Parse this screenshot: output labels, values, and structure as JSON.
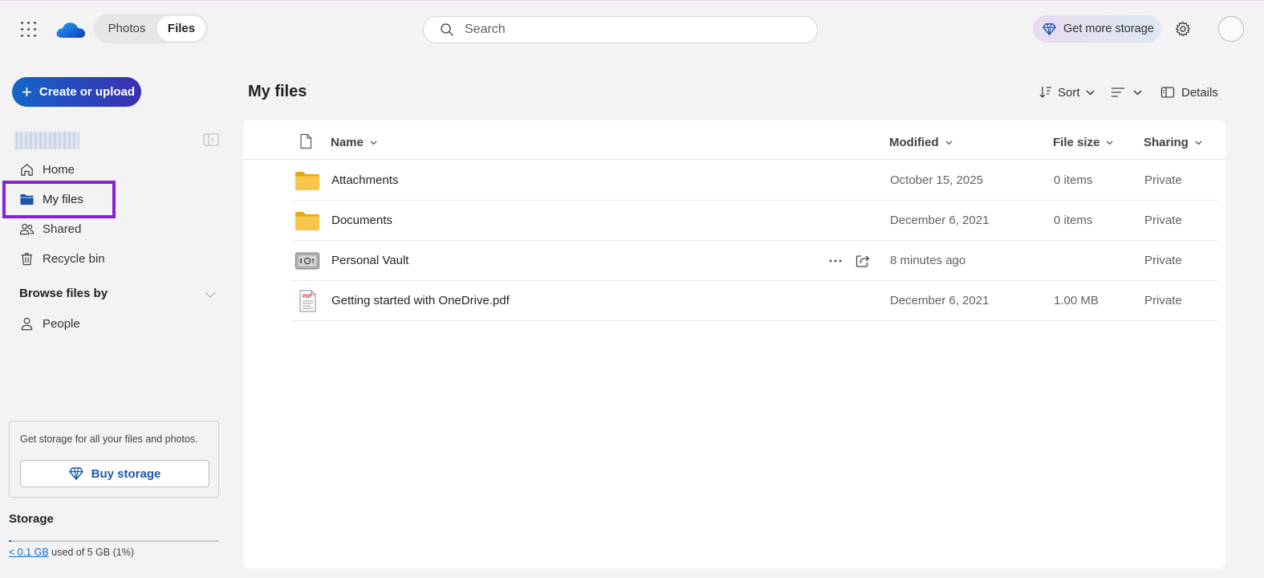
{
  "header": {
    "tabs": [
      {
        "label": "Photos",
        "selected": false
      },
      {
        "label": "Files",
        "selected": true
      }
    ],
    "search": {
      "placeholder": "Search",
      "value": ""
    },
    "get_storage_label": "Get more storage"
  },
  "sidebar": {
    "create_label": "Create or upload",
    "nav": [
      {
        "label": "Home",
        "icon": "home-icon"
      },
      {
        "label": "My files",
        "icon": "folder-icon",
        "active": true
      },
      {
        "label": "Shared",
        "icon": "people-icon"
      },
      {
        "label": "Recycle bin",
        "icon": "trash-icon"
      }
    ],
    "browse_heading": "Browse files by",
    "browse_items": [
      {
        "label": "People",
        "icon": "person-icon"
      }
    ],
    "promo": {
      "text": "Get storage for all your files and photos.",
      "buy_label": "Buy storage"
    },
    "storage": {
      "heading": "Storage",
      "used_link": "< 0.1 GB",
      "used_rest": " used of 5 GB (1%)",
      "percent": 1
    }
  },
  "main": {
    "title": "My files",
    "commands": {
      "sort": "Sort",
      "details": "Details"
    },
    "columns": {
      "name": "Name",
      "modified": "Modified",
      "size": "File size",
      "sharing": "Sharing"
    },
    "rows": [
      {
        "name": "Attachments",
        "type": "folder",
        "modified": "October 15, 2025",
        "size": "0 items",
        "sharing": "Private"
      },
      {
        "name": "Documents",
        "type": "folder",
        "modified": "December 6, 2021",
        "size": "0 items",
        "sharing": "Private"
      },
      {
        "name": "Personal Vault",
        "type": "vault",
        "modified": "8 minutes ago",
        "size": "",
        "sharing": "Private"
      },
      {
        "name": "Getting started with OneDrive.pdf",
        "type": "pdf",
        "modified": "December 6, 2021",
        "size": "1.00 MB",
        "sharing": "Private"
      }
    ]
  },
  "colors": {
    "accent": "#0f6cbd",
    "highlight": "#8a1fd6",
    "folder": "#f5c13d"
  }
}
